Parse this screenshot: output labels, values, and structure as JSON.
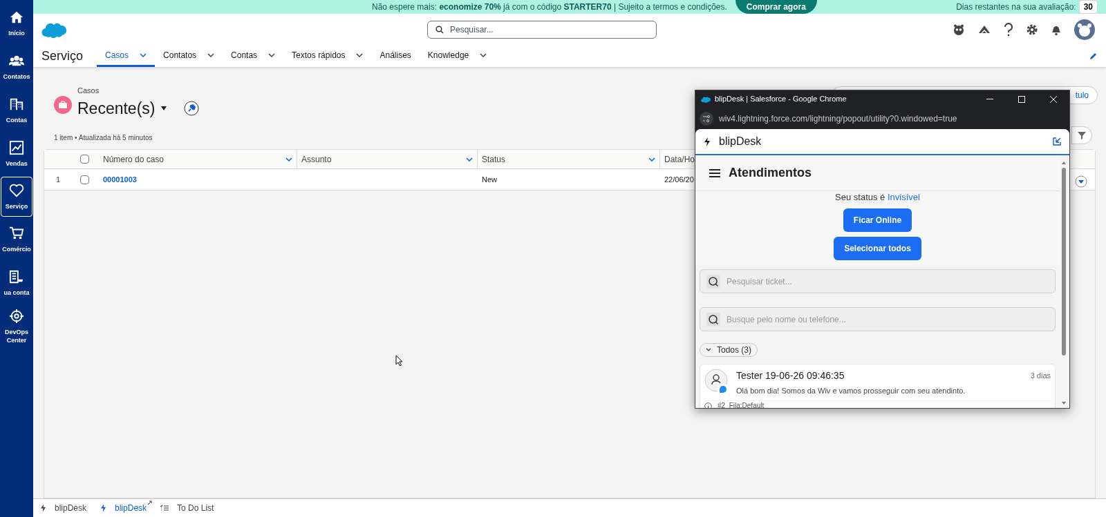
{
  "promo_banner": {
    "text": "Não espere mais: **economize 70%** já com o código **STARTER70** | Sujeito a termos e condições.",
    "button": "Comprar agora",
    "trial_label": "Dias restantes na sua avaliação:",
    "trial_days": "30"
  },
  "nav_sidebar": [
    {
      "label": "Início",
      "kind": "home",
      "selected": false
    },
    {
      "label": "Contatos",
      "kind": "people",
      "selected": false
    },
    {
      "label": "Contas",
      "kind": "building",
      "selected": false
    },
    {
      "label": "Vendas",
      "kind": "chart",
      "selected": false
    },
    {
      "label": "Serviço",
      "kind": "heart",
      "selected": true
    },
    {
      "label": "Comércio",
      "kind": "cart",
      "selected": false
    },
    {
      "label": "ua conta",
      "kind": "store",
      "selected": false
    },
    {
      "label": "DevOps Center",
      "kind": "target",
      "selected": false
    }
  ],
  "header": {
    "search_placeholder": "Pesquisar..."
  },
  "app_nav": {
    "app_name": "Serviço",
    "tabs": [
      {
        "label": "Casos",
        "selected": true,
        "has_menu": true
      },
      {
        "label": "Contatos",
        "selected": false,
        "has_menu": true
      },
      {
        "label": "Contas",
        "selected": false,
        "has_menu": true
      },
      {
        "label": "Textos rápidos",
        "selected": false,
        "has_menu": true
      },
      {
        "label": "Análises",
        "selected": false,
        "has_menu": false
      },
      {
        "label": "Knowledge",
        "selected": false,
        "has_menu": true
      }
    ]
  },
  "list_view": {
    "object_label": "Casos",
    "title": "Recente(s)",
    "summary": "1 item • Atualizada há 5 minutos",
    "header_button_fragment": "tulo",
    "select_all_checked": false,
    "columns": [
      "Número do caso",
      "Assunto",
      "Status",
      "Data/Ho"
    ],
    "rows": [
      {
        "index": "1",
        "checked": false,
        "number": "00001003",
        "status": "New",
        "date": "22/06/20"
      }
    ]
  },
  "popup": {
    "window_title": "blipDesk | Salesforce - Google Chrome",
    "url": "wiv4.lightning.force.com/lightning/popout/utility?0.windowed=true",
    "panel_title": "blipDesk",
    "heading": "Atendimentos",
    "status_prefix": "Seu status é",
    "status_value": "Invisível",
    "buttons": [
      "Ficar Online",
      "Selecionar todos"
    ],
    "search_fields": [
      {
        "placeholder": "Pesquisar ticket..."
      },
      {
        "placeholder": "Busque pelo nome ou telefone..."
      }
    ],
    "group": {
      "label": "Todos (3)",
      "expanded": true
    },
    "tickets": [
      {
        "name": "Tester 19-06-26 09:46:35",
        "age": "3 dias",
        "message": "Olá bom dia! Somos da Wiv e vamos prosseguir com seu atendinto.",
        "meta": "#2  Fila:Default"
      }
    ]
  },
  "utility_bar": [
    {
      "label": "blipDesk",
      "kind": "utility",
      "selected": false,
      "popped_out": false
    },
    {
      "label": "blipDesk",
      "kind": "utility",
      "selected": true,
      "popped_out": true
    },
    {
      "label": "To Do List",
      "kind": "list",
      "selected": false,
      "popped_out": false
    }
  ]
}
